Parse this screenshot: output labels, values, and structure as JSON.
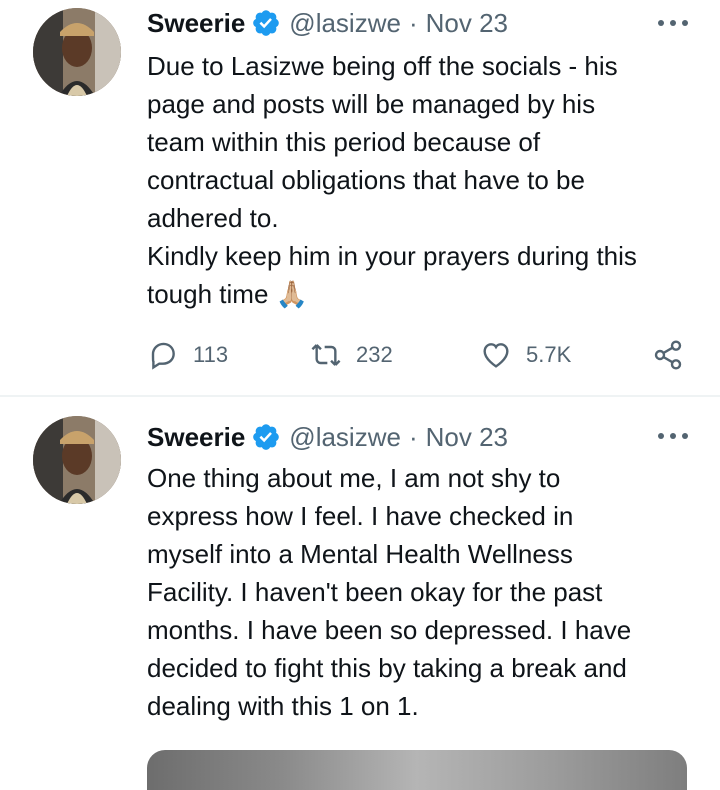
{
  "tweets": [
    {
      "name": "Sweerie",
      "handle": "@lasizwe",
      "separator": "·",
      "date": "Nov 23",
      "text": "Due to Lasizwe being off the socials - his\npage and posts will be managed by his\nteam within this period because of\ncontractual obligations that have to be\nadhered to.\nKindly keep him in your prayers during this\ntough time 🙏🏼",
      "stats": {
        "replies": "113",
        "retweets": "232",
        "likes": "5.7K"
      }
    },
    {
      "name": "Sweerie",
      "handle": "@lasizwe",
      "separator": "·",
      "date": "Nov 23",
      "text": "One thing about me, I am not shy to\nexpress how I feel. I have checked in\nmyself into a Mental Health Wellness\nFacility. I haven't been okay for the past\nmonths. I have been so depressed. I have\ndecided to fight this by taking a break and\ndealing with this 1 on 1."
    }
  ],
  "icons": {
    "verified": "verified-badge-icon",
    "more": "more-horizontal-icon",
    "reply": "reply-icon",
    "retweet": "retweet-icon",
    "like": "heart-icon",
    "share": "share-icon"
  },
  "colors": {
    "verified": "#1d9bf0",
    "muted": "#536471",
    "text": "#0f1419"
  }
}
